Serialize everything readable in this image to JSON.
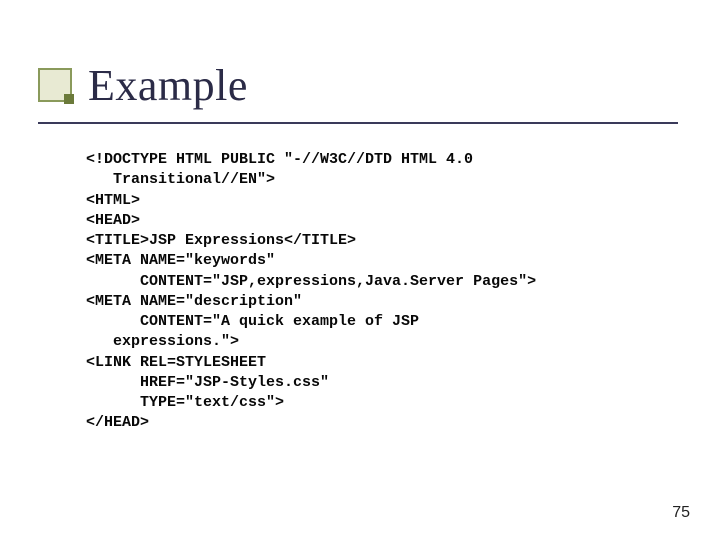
{
  "slide": {
    "title": "Example",
    "page_number": "75"
  },
  "code": {
    "l01": "<!DOCTYPE HTML PUBLIC \"-//W3C//DTD HTML 4.0",
    "l02": "   Transitional//EN\">",
    "l03": "<HTML>",
    "l04": "<HEAD>",
    "l05": "<TITLE>JSP Expressions</TITLE>",
    "l06": "<META NAME=\"keywords\"",
    "l07": "      CONTENT=\"JSP,expressions,Java.Server Pages\">",
    "l08": "<META NAME=\"description\"",
    "l09": "      CONTENT=\"A quick example of JSP",
    "l10": "   expressions.\">",
    "l11": "<LINK REL=STYLESHEET",
    "l12": "      HREF=\"JSP-Styles.css\"",
    "l13": "      TYPE=\"text/css\">",
    "l14": "</HEAD>"
  }
}
